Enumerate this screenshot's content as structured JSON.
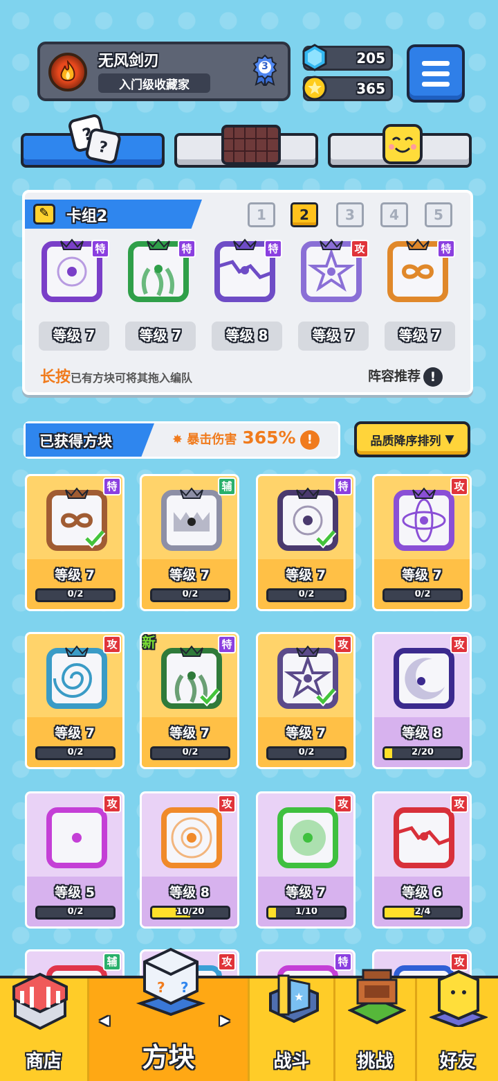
{
  "profile": {
    "name": "无风剑刃",
    "title": "入门级收藏家",
    "rank": "3"
  },
  "currency": {
    "gems": "205",
    "coins": "365"
  },
  "deck": {
    "label": "卡组2",
    "numbers": [
      "1",
      "2",
      "3",
      "4",
      "5"
    ],
    "active": 1,
    "cards": [
      {
        "tag": "特",
        "level": "等级 7",
        "color": "#7a3fc8",
        "motif": "circle"
      },
      {
        "tag": "特",
        "level": "等级 7",
        "color": "#2f9f49",
        "motif": "seaweed"
      },
      {
        "tag": "特",
        "level": "等级 8",
        "color": "#6e4cc6",
        "motif": "crack"
      },
      {
        "tag": "攻",
        "level": "等级 7",
        "color": "#8a6fd6",
        "motif": "star"
      },
      {
        "tag": "特",
        "level": "等级 7",
        "color": "#e0882a",
        "motif": "infinity"
      }
    ],
    "hint_strong": "长按",
    "hint_rest": "已有方块可将其拖入编队",
    "recommend": "阵容推荐",
    "info_icon": "!"
  },
  "obtained": {
    "label": "已获得方块",
    "crit_label": "暴击伤害",
    "crit_value": "365%",
    "info_icon": "!",
    "sort": "品质降序排列"
  },
  "grid": [
    {
      "tag": "特",
      "level": "等级 7",
      "progress": "0/2",
      "fill": 0,
      "bg": "gold",
      "color": "#a05c33",
      "motif": "infinity",
      "check": true
    },
    {
      "tag": "辅",
      "level": "等级 7",
      "progress": "0/2",
      "fill": 0,
      "bg": "gold",
      "color": "#8d8fa6",
      "motif": "jaws"
    },
    {
      "tag": "特",
      "level": "等级 7",
      "progress": "0/2",
      "fill": 0,
      "bg": "gold",
      "color": "#4a3a6e",
      "motif": "circle",
      "check": true
    },
    {
      "tag": "攻",
      "level": "等级 7",
      "progress": "0/2",
      "fill": 0,
      "bg": "gold",
      "color": "#8a4fd6",
      "motif": "orbit"
    },
    {
      "tag": "攻",
      "level": "等级 7",
      "progress": "0/2",
      "fill": 0,
      "bg": "gold",
      "color": "#3a9bc6",
      "motif": "swirl"
    },
    {
      "tag": "特",
      "level": "等级 7",
      "progress": "0/2",
      "fill": 0,
      "bg": "gold",
      "color": "#2f7a3a",
      "motif": "seaweed",
      "check": true,
      "isnew": "新"
    },
    {
      "tag": "攻",
      "level": "等级 7",
      "progress": "0/2",
      "fill": 0,
      "bg": "gold",
      "color": "#5b4a8a",
      "motif": "star",
      "check": true
    },
    {
      "tag": "攻",
      "level": "等级 8",
      "progress": "2/20",
      "fill": 0.1,
      "bg": "purp",
      "color": "#3b2a8e",
      "motif": "moon"
    },
    {
      "tag": "攻",
      "level": "等级 5",
      "progress": "0/2",
      "fill": 0,
      "bg": "purp",
      "color": "#c43fd6",
      "motif": "dot"
    },
    {
      "tag": "攻",
      "level": "等级 8",
      "progress": "10/20",
      "fill": 0.5,
      "bg": "purp",
      "color": "#f08a2a",
      "motif": "target"
    },
    {
      "tag": "攻",
      "level": "等级 7",
      "progress": "1/10",
      "fill": 0.1,
      "bg": "purp",
      "color": "#3fc03f",
      "motif": "biohazard"
    },
    {
      "tag": "攻",
      "level": "等级 6",
      "progress": "2/4",
      "fill": 0.5,
      "bg": "purp",
      "color": "#d8303a",
      "motif": "crack"
    },
    {
      "tag": "辅",
      "level": "",
      "progress": "",
      "fill": 0,
      "bg": "purp",
      "color": "#e0344a",
      "motif": "dot"
    },
    {
      "tag": "攻",
      "level": "",
      "progress": "",
      "fill": 0,
      "bg": "purp",
      "color": "#3aa0d6",
      "motif": "dot"
    },
    {
      "tag": "特",
      "level": "",
      "progress": "",
      "fill": 0,
      "bg": "purp",
      "color": "#c43fd6",
      "motif": "dot"
    },
    {
      "tag": "攻",
      "level": "",
      "progress": "",
      "fill": 0,
      "bg": "purp",
      "color": "#2f5fd6",
      "motif": "dot"
    }
  ],
  "nav": [
    "商店",
    "方块",
    "战斗",
    "挑战",
    "好友"
  ],
  "nav_arrows": [
    "◀",
    "▶"
  ]
}
